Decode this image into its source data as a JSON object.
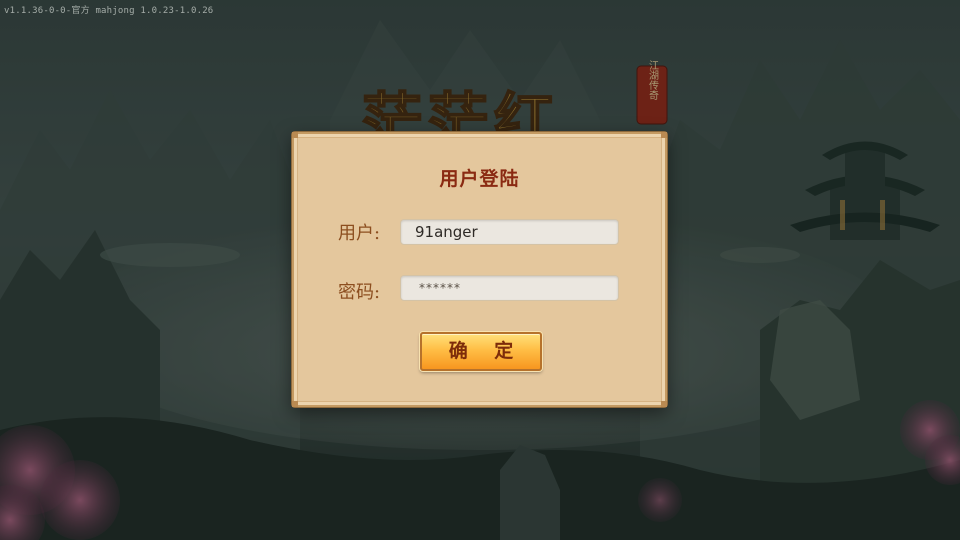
{
  "version": "v1.1.36-0-0-官方 mahjong 1.0.23-1.0.26",
  "login": {
    "title": "用户登陆",
    "user_label": "用户:",
    "password_label": "密码:",
    "username_value": "91anger",
    "password_value": "******",
    "confirm_label": "确 定"
  },
  "logo": {
    "text": "茫茫红",
    "seal": "江湖传奇"
  },
  "colors": {
    "panel": "#e4c79d",
    "title": "#8a2a12",
    "label": "#8c4e1f",
    "button": "#ffbe45"
  }
}
